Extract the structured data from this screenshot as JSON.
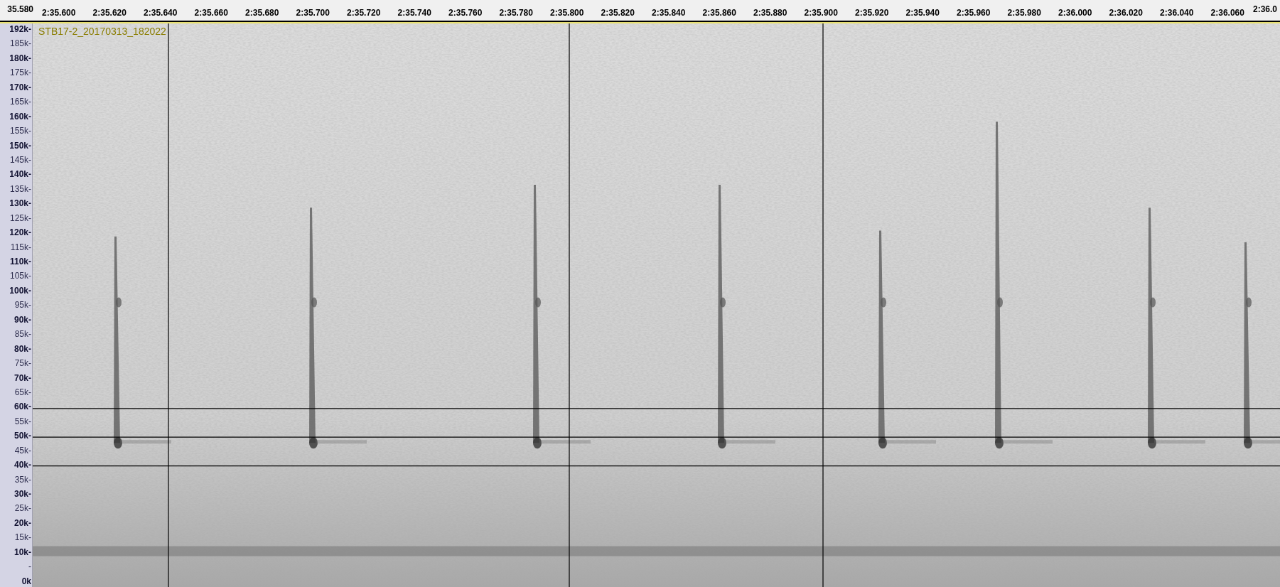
{
  "ruler": {
    "labels": [
      "35.580",
      "2:35.600",
      "2:35.620",
      "2:35.640",
      "2:35.660",
      "2:35.680",
      "2:35.700",
      "2:35.720",
      "2:35.740",
      "2:35.760",
      "2:35.780",
      "2:35.800",
      "2:35.820",
      "2:35.840",
      "2:35.860",
      "2:35.880",
      "2:35.900",
      "2:35.920",
      "2:35.940",
      "2:35.960",
      "2:35.980",
      "2:36.000",
      "2:36.020",
      "2:36.040",
      "2:36.060",
      "2:36.0"
    ]
  },
  "track": {
    "name": "STB17-2_20170313_182022"
  },
  "frequency_axis": {
    "labels": [
      {
        "text": "192k-",
        "major": true
      },
      {
        "text": "185k-",
        "major": false
      },
      {
        "text": "180k-",
        "major": true
      },
      {
        "text": "175k-",
        "major": false
      },
      {
        "text": "170k-",
        "major": true
      },
      {
        "text": "165k-",
        "major": false
      },
      {
        "text": "160k-",
        "major": true
      },
      {
        "text": "155k-",
        "major": false
      },
      {
        "text": "150k-",
        "major": true
      },
      {
        "text": "145k-",
        "major": false
      },
      {
        "text": "140k-",
        "major": true
      },
      {
        "text": "135k-",
        "major": false
      },
      {
        "text": "130k-",
        "major": true
      },
      {
        "text": "125k-",
        "major": false
      },
      {
        "text": "120k-",
        "major": true
      },
      {
        "text": "115k-",
        "major": false
      },
      {
        "text": "110k-",
        "major": true
      },
      {
        "text": "105k-",
        "major": false
      },
      {
        "text": "100k-",
        "major": true
      },
      {
        "text": "95k-",
        "major": false
      },
      {
        "text": "90k-",
        "major": true
      },
      {
        "text": "85k-",
        "major": false
      },
      {
        "text": "80k-",
        "major": true
      },
      {
        "text": "75k-",
        "major": false
      },
      {
        "text": "70k-",
        "major": true
      },
      {
        "text": "65k-",
        "major": false
      },
      {
        "text": "60k-",
        "major": true
      },
      {
        "text": "55k-",
        "major": false
      },
      {
        "text": "50k-",
        "major": true
      },
      {
        "text": "45k-",
        "major": false
      },
      {
        "text": "40k-",
        "major": true
      },
      {
        "text": "35k-",
        "major": false
      },
      {
        "text": "30k-",
        "major": true
      },
      {
        "text": "25k-",
        "major": false
      },
      {
        "text": "20k-",
        "major": true
      },
      {
        "text": "15k-",
        "major": false
      },
      {
        "text": "10k-",
        "major": true
      },
      {
        "text": "-",
        "major": false
      },
      {
        "text": "0k",
        "major": true
      }
    ]
  }
}
